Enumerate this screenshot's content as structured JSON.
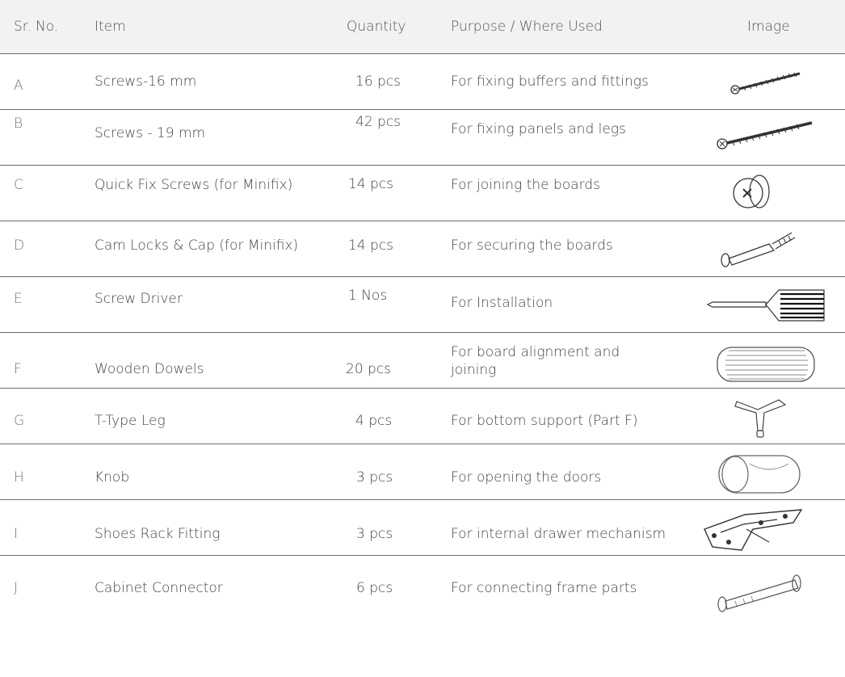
{
  "headers": {
    "sr": "Sr. No.",
    "item": "Item",
    "quantity": "Quantity",
    "purpose": "Purpose / Where Used",
    "image": "Image"
  },
  "rows": [
    {
      "sr": "A",
      "item": "Screws-16 mm",
      "qty": "16 pcs",
      "purpose": "For fixing buffers and fittings",
      "image": "short-screw-icon"
    },
    {
      "sr": "B",
      "item": "Screws - 19 mm",
      "qty": "42 pcs",
      "purpose": "For fixing panels and legs",
      "image": "long-screw-icon"
    },
    {
      "sr": "C",
      "item": "Quick Fix Screws (for Minifix)",
      "qty": "14 pcs",
      "purpose": "For joining the boards",
      "image": "cam-fitting-icon"
    },
    {
      "sr": "D",
      "item": "Cam Locks & Cap (for Minifix)",
      "qty": "14 pcs",
      "purpose": "For securing the boards",
      "image": "cam-bolt-icon"
    },
    {
      "sr": "E",
      "item": "Screw Driver",
      "qty": "1 Nos",
      "purpose": "For Installation",
      "image": "screwdriver-icon"
    },
    {
      "sr": "F",
      "item": "Wooden Dowels",
      "qty": "20 pcs",
      "purpose": "For board alignment and joining",
      "image": "dowel-icon"
    },
    {
      "sr": "G",
      "item": "T-Type Leg",
      "qty": "4  pcs",
      "purpose": "For bottom support (Part F)",
      "image": "t-leg-icon"
    },
    {
      "sr": "H",
      "item": "Knob",
      "qty": "3 pcs",
      "purpose": "For opening the doors",
      "image": "knob-icon"
    },
    {
      "sr": "I",
      "item": "Shoes Rack Fitting",
      "qty": "3 pcs",
      "purpose": "For internal drawer mechanism",
      "image": "rack-fitting-icon"
    },
    {
      "sr": "J",
      "item": "Cabinet Connector",
      "qty": "6 pcs",
      "purpose": "For connecting frame parts",
      "image": "connector-icon"
    }
  ]
}
